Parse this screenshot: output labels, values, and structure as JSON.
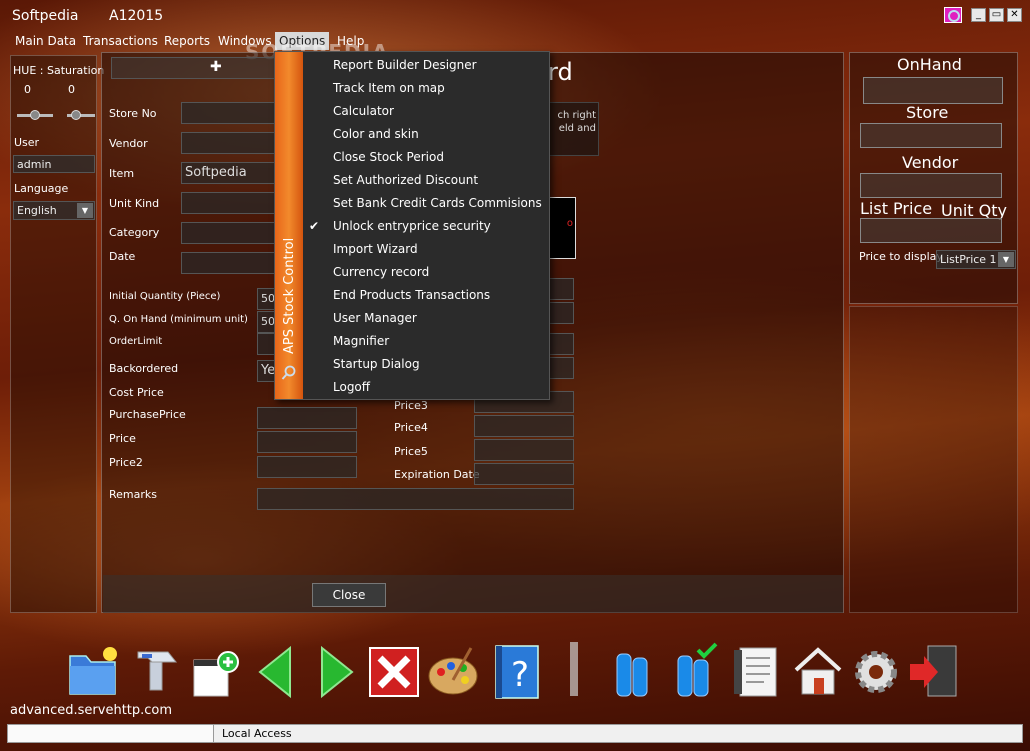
{
  "window": {
    "app_name": "Softpedia",
    "doc_title": "A12015",
    "watermark": "SOFTPEDIA"
  },
  "menubar": {
    "items": [
      "Main Data",
      "Transactions",
      "Reports",
      "Windows",
      "Options",
      "Help"
    ],
    "active": "Options"
  },
  "left_panel": {
    "hue_label": "HUE :",
    "saturation_label": "Saturation",
    "hue_value": "0",
    "saturation_value": "0",
    "user_label": "User",
    "user_value": "admin",
    "language_label": "Language",
    "language_value": "English"
  },
  "form": {
    "heading_suffix": "rd",
    "hint_line1": "ch right",
    "hint_line2": "eld and",
    "image_marker": "o",
    "labels": {
      "store_no": "Store No",
      "vendor": "Vendor",
      "item": "Item",
      "unit_kind": "Unit Kind",
      "category": "Category",
      "date": "Date",
      "initial_quantity": "Initial Quantity (Piece)",
      "q_on_hand": "Q. On Hand (minimum unit)",
      "order_limit": "OrderLimit",
      "backordered": "Backordered",
      "cost_price": "Cost Price",
      "purchase_price": "PurchasePrice",
      "price": "Price",
      "price2": "Price2",
      "price3": "Price3",
      "price4": "Price4",
      "price5": "Price5",
      "expiration_date": "Expiration Date",
      "remarks": "Remarks"
    },
    "values": {
      "item": "Softpedia",
      "initial_quantity": "50",
      "q_on_hand": "50",
      "backordered": "Ye"
    },
    "close_label": "Close"
  },
  "right_panel": {
    "onhand_label": "OnHand",
    "store_label": "Store",
    "vendor_label": "Vendor",
    "list_price_label": "List Price",
    "unit_qty_label": "Unit Qty",
    "price_to_display_label": "Price to display",
    "price_to_display_value": "ListPrice 1"
  },
  "options_menu": {
    "side_title": "APS Stock Control",
    "items": [
      "Report Builder Designer",
      "Track Item on map",
      "Calculator",
      "Color and skin",
      "Close Stock Period",
      "Set Authorized Discount",
      "Set Bank Credit Cards Commisions",
      "Unlock entryprice security",
      "Import Wizard",
      "Currency record",
      "End Products Transactions",
      "User Manager",
      "Magnifier",
      "Startup Dialog",
      "Logoff"
    ],
    "checked_item": "Unlock entryprice security"
  },
  "toolbar_icons": [
    "open-folder-icon",
    "barcode-scanner-icon",
    "add-document-icon",
    "back-arrow-icon",
    "forward-arrow-icon",
    "delete-icon",
    "palette-icon",
    "help-book-icon",
    "bottles-icon",
    "bottles-check-icon",
    "report-document-icon",
    "home-icon",
    "settings-gear-icon",
    "exit-door-icon"
  ],
  "status": {
    "site": "advanced.servehttp.com",
    "local_access": "Local Access"
  },
  "colors": {
    "menu_strip": "#ee7a22",
    "dropdown_bg": "#2b2b2b",
    "menu_active_bg": "#d9d9d9"
  }
}
